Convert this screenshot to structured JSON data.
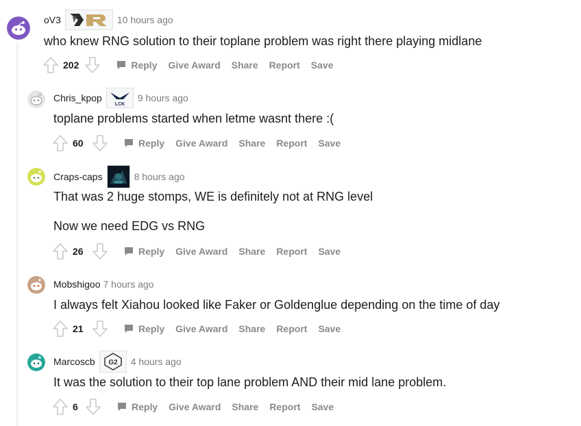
{
  "comments": [
    {
      "username": "oV3",
      "flair": "RNG team flair",
      "timestamp": "10 hours ago",
      "body": [
        "who knew RNG solution to their toplane problem was right there playing midlane"
      ],
      "score": "202"
    },
    {
      "username": "Chris_kpop",
      "flair": "LCK flair",
      "timestamp": "9 hours ago",
      "body": [
        "toplane problems started when letme wasnt there :("
      ],
      "score": "60"
    },
    {
      "username": "Craps-caps",
      "flair": "Dark flair",
      "timestamp": "8 hours ago",
      "body": [
        "That was 2 huge stomps, WE is definitely not at RNG level",
        "Now we need EDG vs RNG"
      ],
      "score": "26"
    },
    {
      "username": "Mobshigoo",
      "timestamp": "7 hours ago",
      "body": [
        "I always felt Xiahou looked like Faker or Goldenglue depending on the time of day"
      ],
      "score": "21"
    },
    {
      "username": "Marcoscb",
      "flair": "G2 flair",
      "timestamp": "4 hours ago",
      "body": [
        "It was the solution to their top lane problem AND their mid lane problem."
      ],
      "score": "6"
    }
  ],
  "actions": {
    "reply": "Reply",
    "give_award": "Give Award",
    "share": "Share",
    "report": "Report",
    "save": "Save"
  },
  "colors": {
    "action_gray": "#878a8c",
    "meta_gray": "#7c7c7c",
    "thread_line": "#edeff1",
    "avatar_purple": "#7e57c2",
    "avatar_yellow": "#d4e157",
    "avatar_teal": "#26a69a",
    "avatar_brown": "#c8a287"
  }
}
